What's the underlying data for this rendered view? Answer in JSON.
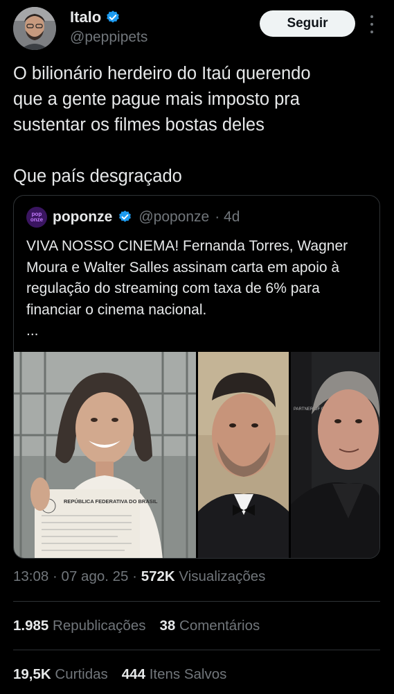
{
  "author": {
    "name": "Italo",
    "handle": "@peppipets",
    "follow_label": "Seguir"
  },
  "tweet": {
    "paragraph1": "O bilionário herdeiro do Itaú querendo\nque a gente pague mais imposto pra\nsustentar os filmes bostas deles",
    "paragraph2": "Que país desgraçado"
  },
  "quote": {
    "avatar_text": "pop onze",
    "name": "poponze",
    "handle": "@poponze",
    "time": "· 4d",
    "text": "VIVA NOSSO CINEMA! Fernanda Torres, Wagner Moura e Walter Salles assinam carta em apoio à regulação do streaming com taxa de 6% para financiar o cinema nacional.",
    "ellipsis": "...",
    "document_heading": "REPÚBLICA FEDERATIVA DO BRASIL",
    "banner_text": "PARTNER OF CHOICE"
  },
  "meta": {
    "time": "13:08",
    "date": "07 ago. 25",
    "views_count": "572K",
    "views_label": "Visualizações"
  },
  "stats": {
    "reposts_count": "1.985",
    "reposts_label": "Republicações",
    "comments_count": "38",
    "comments_label": "Comentários",
    "likes_count": "19,5K",
    "likes_label": "Curtidas",
    "bookmarks_count": "444",
    "bookmarks_label": "Itens Salvos"
  },
  "colors": {
    "background": "#000000",
    "text": "#e7e9ea",
    "muted": "#71767b",
    "verified": "#1d9bf0",
    "border": "#2f3336"
  }
}
